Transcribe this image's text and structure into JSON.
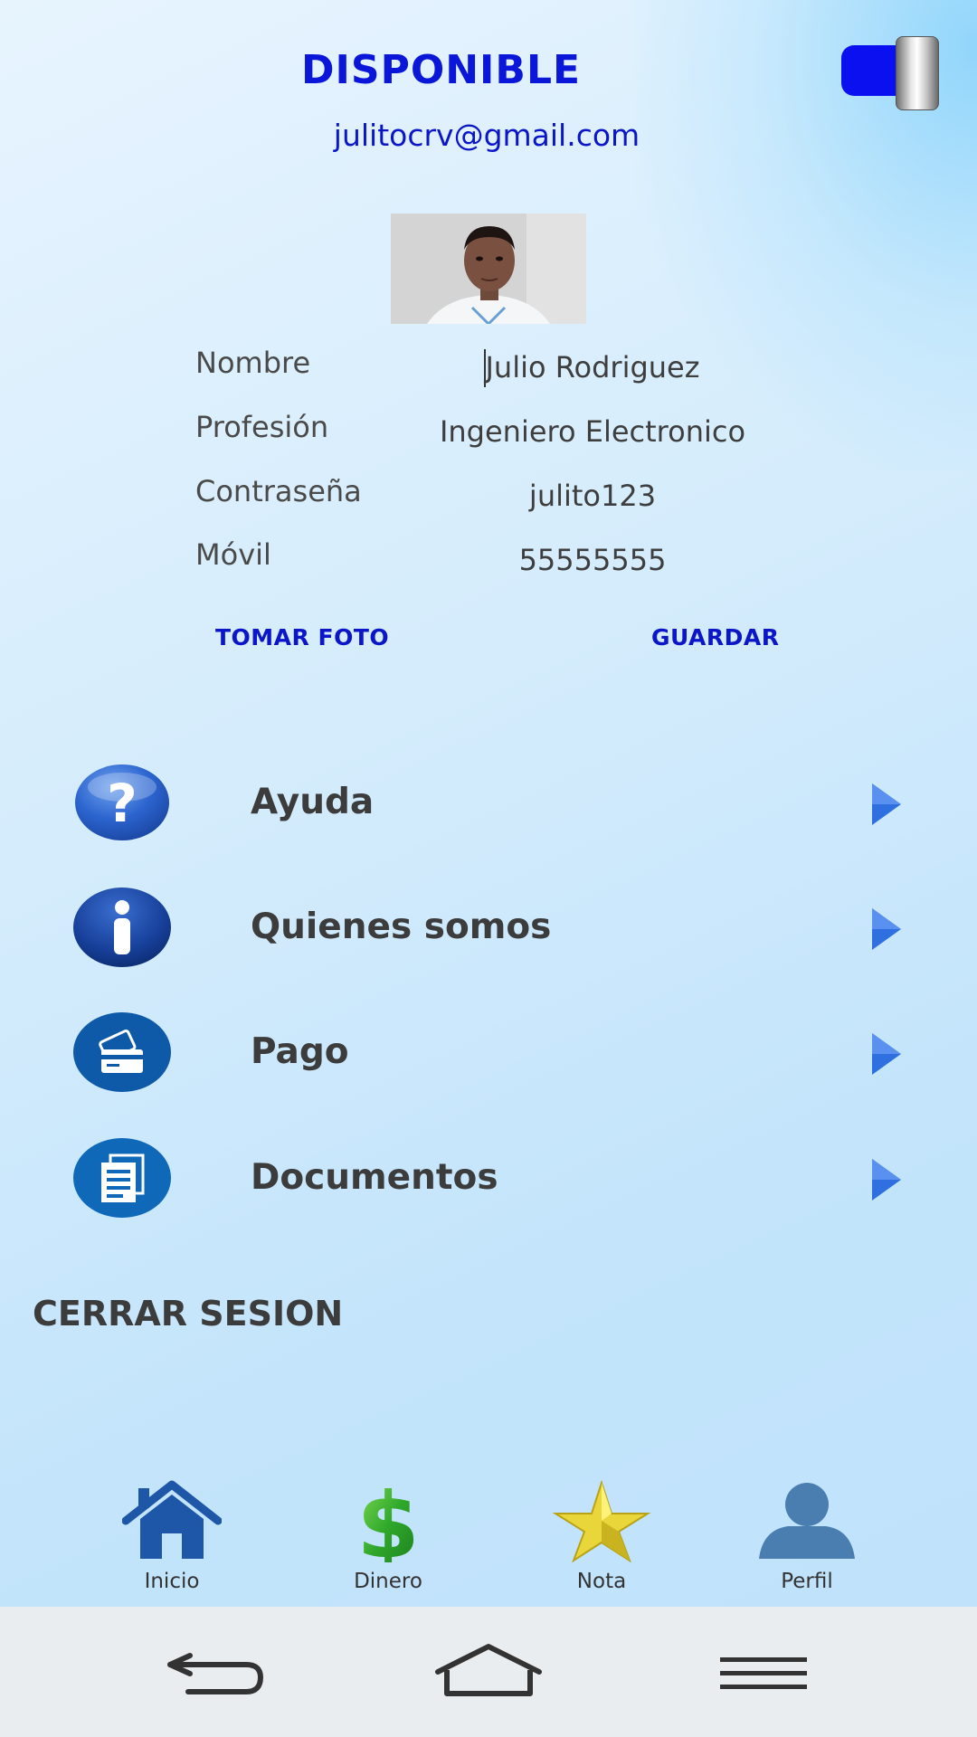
{
  "header": {
    "status_title": "DISPONIBLE",
    "availability_toggle": "on",
    "email": "julitocrv@gmail.com"
  },
  "profile": {
    "fields": [
      {
        "label": "Nombre",
        "value": "Julio Rodriguez"
      },
      {
        "label": "Profesión",
        "value": "Ingeniero Electronico"
      },
      {
        "label": "Contraseña",
        "value": "julito123"
      },
      {
        "label": "Móvil",
        "value": "55555555"
      }
    ],
    "take_photo_label": "TOMAR FOTO",
    "save_label": "GUARDAR"
  },
  "menu": [
    {
      "label": "Ayuda",
      "icon": "help-question-icon"
    },
    {
      "label": "Quienes somos",
      "icon": "info-icon"
    },
    {
      "label": " Pago",
      "icon": "credit-card-icon"
    },
    {
      "label": "Documentos",
      "icon": "documents-icon"
    }
  ],
  "logout_label": "CERRAR SESION",
  "tabbar": [
    {
      "label": "Inicio",
      "icon": "home-icon"
    },
    {
      "label": "Dinero",
      "icon": "dollar-icon"
    },
    {
      "label": "Nota",
      "icon": "star-icon"
    },
    {
      "label": "Perfil",
      "icon": "person-icon"
    }
  ],
  "colors": {
    "accent_blue": "#0a16d8",
    "text_dark": "#3c3c3c",
    "background_light": "#d6ecfc"
  }
}
